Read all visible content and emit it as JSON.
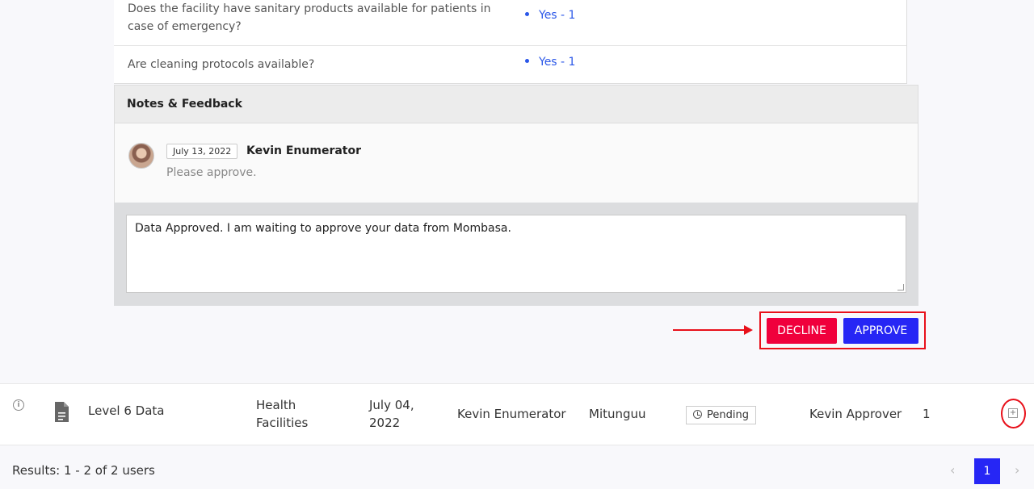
{
  "questions": [
    {
      "question": "Does the facility have sanitary products available for patients in case of emergency?",
      "answer": "Yes - 1"
    },
    {
      "question": "Are cleaning protocols available?",
      "answer": "Yes - 1"
    }
  ],
  "notes": {
    "header": "Notes & Feedback",
    "entry": {
      "date": "July 13, 2022",
      "author": "Kevin Enumerator",
      "text": "Please approve."
    },
    "reply_value": "Data Approved. I am waiting to approve your data from Mombasa."
  },
  "actions": {
    "decline_label": "DECLINE",
    "approve_label": "APPROVE"
  },
  "row": {
    "name": "Level 6 Data",
    "category": "Health Facilities",
    "date": "July 04, 2022",
    "enumerator": "Kevin Enumerator",
    "location": "Mitunguu",
    "status": "Pending",
    "approver": "Kevin Approver",
    "count": "1"
  },
  "footer": {
    "results": "Results: 1 - 2 of 2 users",
    "page": "1",
    "prev": "‹",
    "next": "›"
  },
  "colors": {
    "accent": "#2626f5",
    "danger": "#f0003c",
    "annotation": "#e8101a",
    "link": "#2b57e8"
  }
}
